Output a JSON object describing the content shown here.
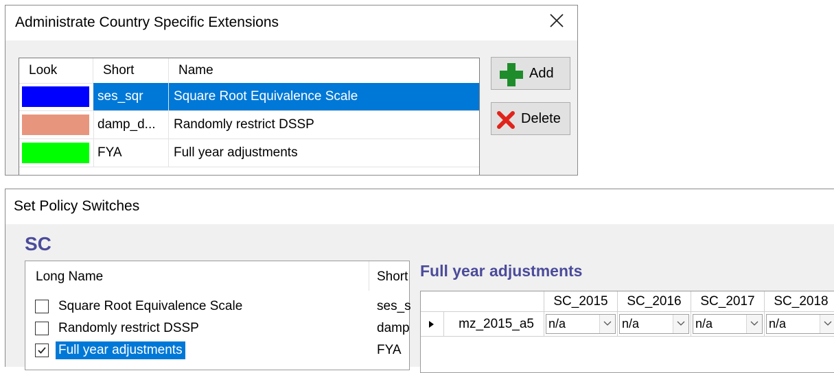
{
  "dialog1": {
    "title": "Administrate Country Specific Extensions",
    "columns": [
      "Look",
      "Short",
      "Name"
    ],
    "rows": [
      {
        "color": "#0000ff",
        "short": "ses_sqr",
        "name": "Square Root Equivalence Scale",
        "selected": true
      },
      {
        "color": "#e8957d",
        "short": "damp_d...",
        "name": "Randomly restrict DSSP",
        "selected": false
      },
      {
        "color": "#00ff00",
        "short": "FYA",
        "name": "Full year adjustments",
        "selected": false
      }
    ],
    "add_label": "Add",
    "delete_label": "Delete",
    "icons": {
      "close": "close-icon",
      "add": "green-plus-icon",
      "delete": "red-x-icon"
    }
  },
  "dialog2": {
    "title": "Set Policy Switches",
    "section": "SC",
    "list_columns": [
      "Long Name",
      "Short"
    ],
    "list_rows": [
      {
        "name": "Square Root Equivalence Scale",
        "short": "ses_s",
        "checked": false,
        "selected": false
      },
      {
        "name": "Randomly restrict DSSP",
        "short": "damp",
        "checked": false,
        "selected": false
      },
      {
        "name": "Full year adjustments",
        "short": "FYA",
        "checked": true,
        "selected": true
      }
    ],
    "detail_title": "Full year adjustments",
    "grid_columns": [
      "SC_2015",
      "SC_2016",
      "SC_2017",
      "SC_2018"
    ],
    "grid_rows": [
      {
        "name": "mz_2015_a5",
        "values": [
          "n/a",
          "n/a",
          "n/a",
          "n/a"
        ]
      }
    ]
  }
}
